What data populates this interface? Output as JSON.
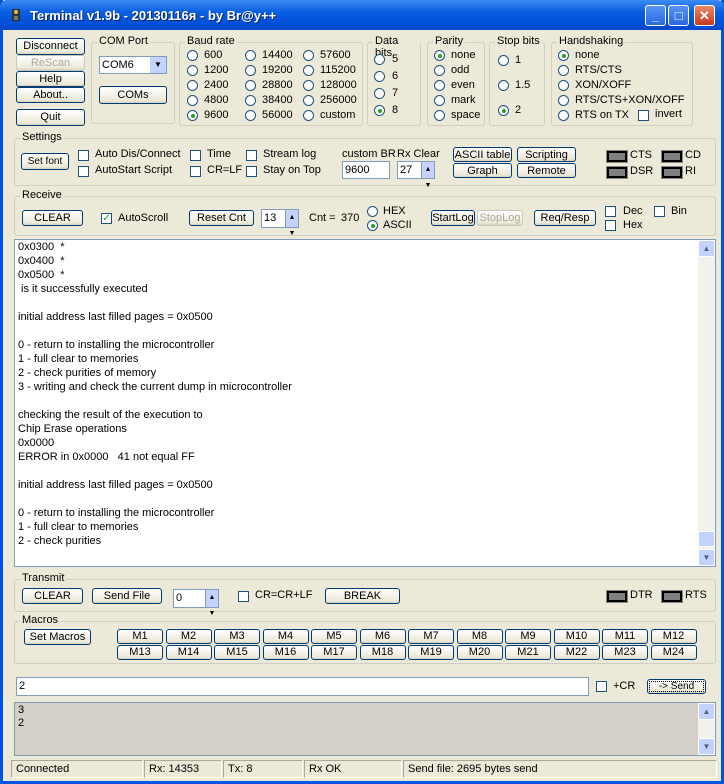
{
  "window": {
    "title": "Terminal v1.9b - 20130116я - by Br@y++",
    "minimize": "_",
    "maximize": "□",
    "close": "✕"
  },
  "top": {
    "disconnect": "Disconnect",
    "rescan": "ReScan",
    "help": "Help",
    "about": "About..",
    "quit": "Quit"
  },
  "com": {
    "title": "COM Port",
    "value": "COM6",
    "coms": "COMs"
  },
  "baud": {
    "title": "Baud rate",
    "options": [
      "600",
      "1200",
      "2400",
      "4800",
      "9600",
      "14400",
      "19200",
      "28800",
      "38400",
      "56000",
      "57600",
      "115200",
      "128000",
      "256000",
      "custom"
    ],
    "selected": "9600"
  },
  "databits": {
    "title": "Data bits",
    "options": [
      "5",
      "6",
      "7",
      "8"
    ],
    "selected": "8"
  },
  "parity": {
    "title": "Parity",
    "options": [
      "none",
      "odd",
      "even",
      "mark",
      "space"
    ],
    "selected": "none"
  },
  "stopbits": {
    "title": "Stop bits",
    "options": [
      "1",
      "1.5",
      "2"
    ],
    "selected": "2"
  },
  "handshaking": {
    "title": "Handshaking",
    "options": [
      "none",
      "RTS/CTS",
      "XON/XOFF",
      "RTS/CTS+XON/XOFF",
      "RTS on TX"
    ],
    "invert": "invert",
    "selected": "none"
  },
  "settings": {
    "title": "Settings",
    "setfont": "Set font",
    "auto_dis": "Auto Dis/Connect",
    "autostart": "AutoStart Script",
    "time": "Time",
    "crlf": "CR=LF",
    "streamlog": "Stream log",
    "stayontop": "Stay on Top",
    "custom_br_label": "custom BR",
    "custom_br_value": "9600",
    "rxclear_label": "Rx Clear",
    "rxclear_value": "27",
    "ascii_table": "ASCII table",
    "scripting": "Scripting",
    "graph": "Graph",
    "remote": "Remote",
    "cts": "CTS",
    "cd": "CD",
    "dsr": "DSR",
    "ri": "RI"
  },
  "receive": {
    "title": "Receive",
    "clear": "CLEAR",
    "autoscroll": "AutoScroll",
    "reset_cnt": "Reset Cnt",
    "cnt_value": "13",
    "cnt_label": "Cnt =",
    "cnt": "370",
    "hex": "HEX",
    "ascii": "ASCII",
    "startlog": "StartLog",
    "stoplog": "StopLog",
    "reqresp": "Req/Resp",
    "dec": "Dec",
    "hex2": "Hex",
    "bin": "Bin"
  },
  "terminal_lines": [
    "0x0300  *",
    "0x0400  *",
    "0x0500  *",
    " is it successfully executed",
    "",
    "initial address last filled pages = 0x0500",
    "",
    "0 - return to installing the microcontroller",
    "1 - full clear to memories",
    "2 - check purities of memory",
    "3 - writing and check the current dump in microcontroller",
    "",
    "checking the result of the execution to",
    "Chip Erase operations",
    "0x0000",
    "ERROR in 0x0000   41 not equal FF",
    "",
    "initial address last filled pages = 0x0500",
    "",
    "0 - return to installing the microcontroller",
    "1 - full clear to memories",
    "2 - check purities"
  ],
  "transmit": {
    "title": "Transmit",
    "clear": "CLEAR",
    "sendfile": "Send File",
    "value": "0",
    "crcrlf": "CR=CR+LF",
    "break": "BREAK",
    "dtr": "DTR",
    "rts": "RTS"
  },
  "macros": {
    "title": "Macros",
    "set": "Set Macros",
    "row1": [
      "M1",
      "M2",
      "M3",
      "M4",
      "M5",
      "M6",
      "M7",
      "M8",
      "M9",
      "M10",
      "M11",
      "M12"
    ],
    "row2": [
      "M13",
      "M14",
      "M15",
      "M16",
      "M17",
      "M18",
      "M19",
      "M20",
      "M21",
      "M22",
      "M23",
      "M24"
    ]
  },
  "send": {
    "input": "2",
    "cr": "+CR",
    "send": "-> Send"
  },
  "sent_lines": [
    "3",
    "2"
  ],
  "status": {
    "connected": "Connected",
    "rx": "Rx: 14353",
    "tx": "Tx: 8",
    "rxok": "Rx OK",
    "sendfile": "Send file: 2695 bytes send"
  }
}
